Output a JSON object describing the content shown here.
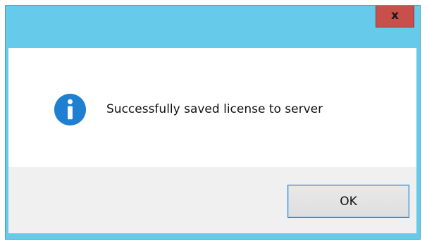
{
  "titlebar": {
    "close_label": "x",
    "color": "#66cbea",
    "close_color": "#c7504b"
  },
  "dialog": {
    "icon": "info-icon",
    "icon_color": "#1f7fd1",
    "message": "Successfully saved license to server"
  },
  "footer": {
    "ok_label": "OK"
  }
}
